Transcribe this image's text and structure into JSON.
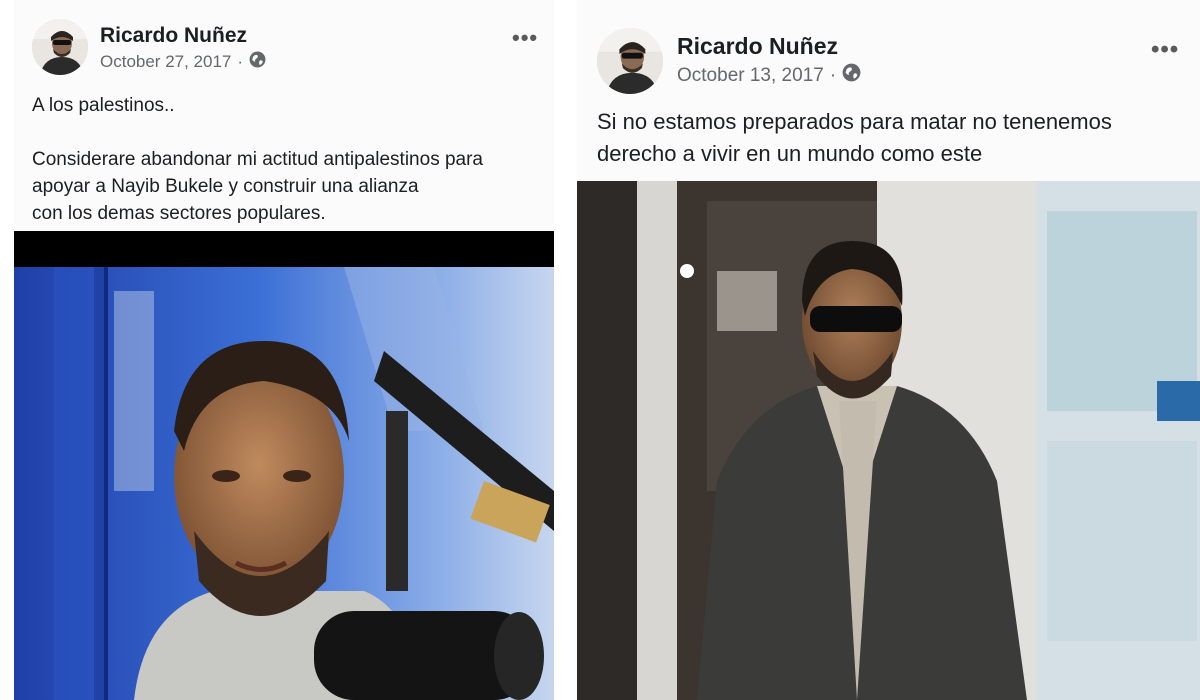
{
  "posts": [
    {
      "author": "Ricardo Nuñez",
      "date": "October 27, 2017",
      "separator": "·",
      "audience_icon": "globe-icon",
      "more_icon": "more-options-icon",
      "more_label": "•••",
      "text": "A los palestinos..\n\nConsiderare abandonar mi actitud antipalestinos para\napoyar a Nayib Bukele y construir una alianza\ncon los demas sectores populares.",
      "photo": "radio-studio-photo"
    },
    {
      "author": "Ricardo Nuñez",
      "date": "October 13, 2017",
      "separator": "·",
      "audience_icon": "globe-icon",
      "more_icon": "more-options-icon",
      "more_label": "•••",
      "text": "Si no estamos preparados para matar no tenenemos\nderecho a vivir en un mundo como este",
      "photo": "man-in-suit-photo"
    }
  ],
  "colors": {
    "name": "#1c1e21",
    "meta": "#65676b",
    "card_background": "#fbfbfb"
  }
}
